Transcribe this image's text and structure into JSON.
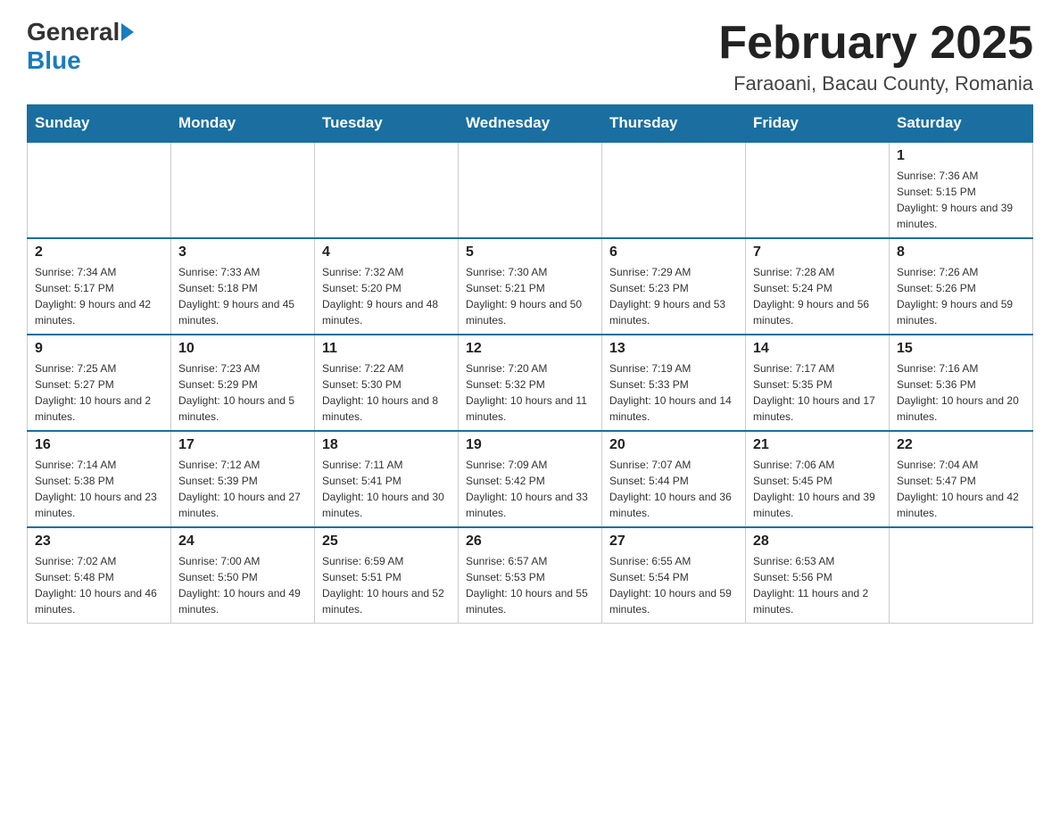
{
  "logo": {
    "general": "General",
    "blue": "Blue"
  },
  "title": "February 2025",
  "subtitle": "Faraoani, Bacau County, Romania",
  "days_of_week": [
    "Sunday",
    "Monday",
    "Tuesday",
    "Wednesday",
    "Thursday",
    "Friday",
    "Saturday"
  ],
  "weeks": [
    [
      {
        "day": "",
        "info": ""
      },
      {
        "day": "",
        "info": ""
      },
      {
        "day": "",
        "info": ""
      },
      {
        "day": "",
        "info": ""
      },
      {
        "day": "",
        "info": ""
      },
      {
        "day": "",
        "info": ""
      },
      {
        "day": "1",
        "info": "Sunrise: 7:36 AM\nSunset: 5:15 PM\nDaylight: 9 hours and 39 minutes."
      }
    ],
    [
      {
        "day": "2",
        "info": "Sunrise: 7:34 AM\nSunset: 5:17 PM\nDaylight: 9 hours and 42 minutes."
      },
      {
        "day": "3",
        "info": "Sunrise: 7:33 AM\nSunset: 5:18 PM\nDaylight: 9 hours and 45 minutes."
      },
      {
        "day": "4",
        "info": "Sunrise: 7:32 AM\nSunset: 5:20 PM\nDaylight: 9 hours and 48 minutes."
      },
      {
        "day": "5",
        "info": "Sunrise: 7:30 AM\nSunset: 5:21 PM\nDaylight: 9 hours and 50 minutes."
      },
      {
        "day": "6",
        "info": "Sunrise: 7:29 AM\nSunset: 5:23 PM\nDaylight: 9 hours and 53 minutes."
      },
      {
        "day": "7",
        "info": "Sunrise: 7:28 AM\nSunset: 5:24 PM\nDaylight: 9 hours and 56 minutes."
      },
      {
        "day": "8",
        "info": "Sunrise: 7:26 AM\nSunset: 5:26 PM\nDaylight: 9 hours and 59 minutes."
      }
    ],
    [
      {
        "day": "9",
        "info": "Sunrise: 7:25 AM\nSunset: 5:27 PM\nDaylight: 10 hours and 2 minutes."
      },
      {
        "day": "10",
        "info": "Sunrise: 7:23 AM\nSunset: 5:29 PM\nDaylight: 10 hours and 5 minutes."
      },
      {
        "day": "11",
        "info": "Sunrise: 7:22 AM\nSunset: 5:30 PM\nDaylight: 10 hours and 8 minutes."
      },
      {
        "day": "12",
        "info": "Sunrise: 7:20 AM\nSunset: 5:32 PM\nDaylight: 10 hours and 11 minutes."
      },
      {
        "day": "13",
        "info": "Sunrise: 7:19 AM\nSunset: 5:33 PM\nDaylight: 10 hours and 14 minutes."
      },
      {
        "day": "14",
        "info": "Sunrise: 7:17 AM\nSunset: 5:35 PM\nDaylight: 10 hours and 17 minutes."
      },
      {
        "day": "15",
        "info": "Sunrise: 7:16 AM\nSunset: 5:36 PM\nDaylight: 10 hours and 20 minutes."
      }
    ],
    [
      {
        "day": "16",
        "info": "Sunrise: 7:14 AM\nSunset: 5:38 PM\nDaylight: 10 hours and 23 minutes."
      },
      {
        "day": "17",
        "info": "Sunrise: 7:12 AM\nSunset: 5:39 PM\nDaylight: 10 hours and 27 minutes."
      },
      {
        "day": "18",
        "info": "Sunrise: 7:11 AM\nSunset: 5:41 PM\nDaylight: 10 hours and 30 minutes."
      },
      {
        "day": "19",
        "info": "Sunrise: 7:09 AM\nSunset: 5:42 PM\nDaylight: 10 hours and 33 minutes."
      },
      {
        "day": "20",
        "info": "Sunrise: 7:07 AM\nSunset: 5:44 PM\nDaylight: 10 hours and 36 minutes."
      },
      {
        "day": "21",
        "info": "Sunrise: 7:06 AM\nSunset: 5:45 PM\nDaylight: 10 hours and 39 minutes."
      },
      {
        "day": "22",
        "info": "Sunrise: 7:04 AM\nSunset: 5:47 PM\nDaylight: 10 hours and 42 minutes."
      }
    ],
    [
      {
        "day": "23",
        "info": "Sunrise: 7:02 AM\nSunset: 5:48 PM\nDaylight: 10 hours and 46 minutes."
      },
      {
        "day": "24",
        "info": "Sunrise: 7:00 AM\nSunset: 5:50 PM\nDaylight: 10 hours and 49 minutes."
      },
      {
        "day": "25",
        "info": "Sunrise: 6:59 AM\nSunset: 5:51 PM\nDaylight: 10 hours and 52 minutes."
      },
      {
        "day": "26",
        "info": "Sunrise: 6:57 AM\nSunset: 5:53 PM\nDaylight: 10 hours and 55 minutes."
      },
      {
        "day": "27",
        "info": "Sunrise: 6:55 AM\nSunset: 5:54 PM\nDaylight: 10 hours and 59 minutes."
      },
      {
        "day": "28",
        "info": "Sunrise: 6:53 AM\nSunset: 5:56 PM\nDaylight: 11 hours and 2 minutes."
      },
      {
        "day": "",
        "info": ""
      }
    ]
  ]
}
